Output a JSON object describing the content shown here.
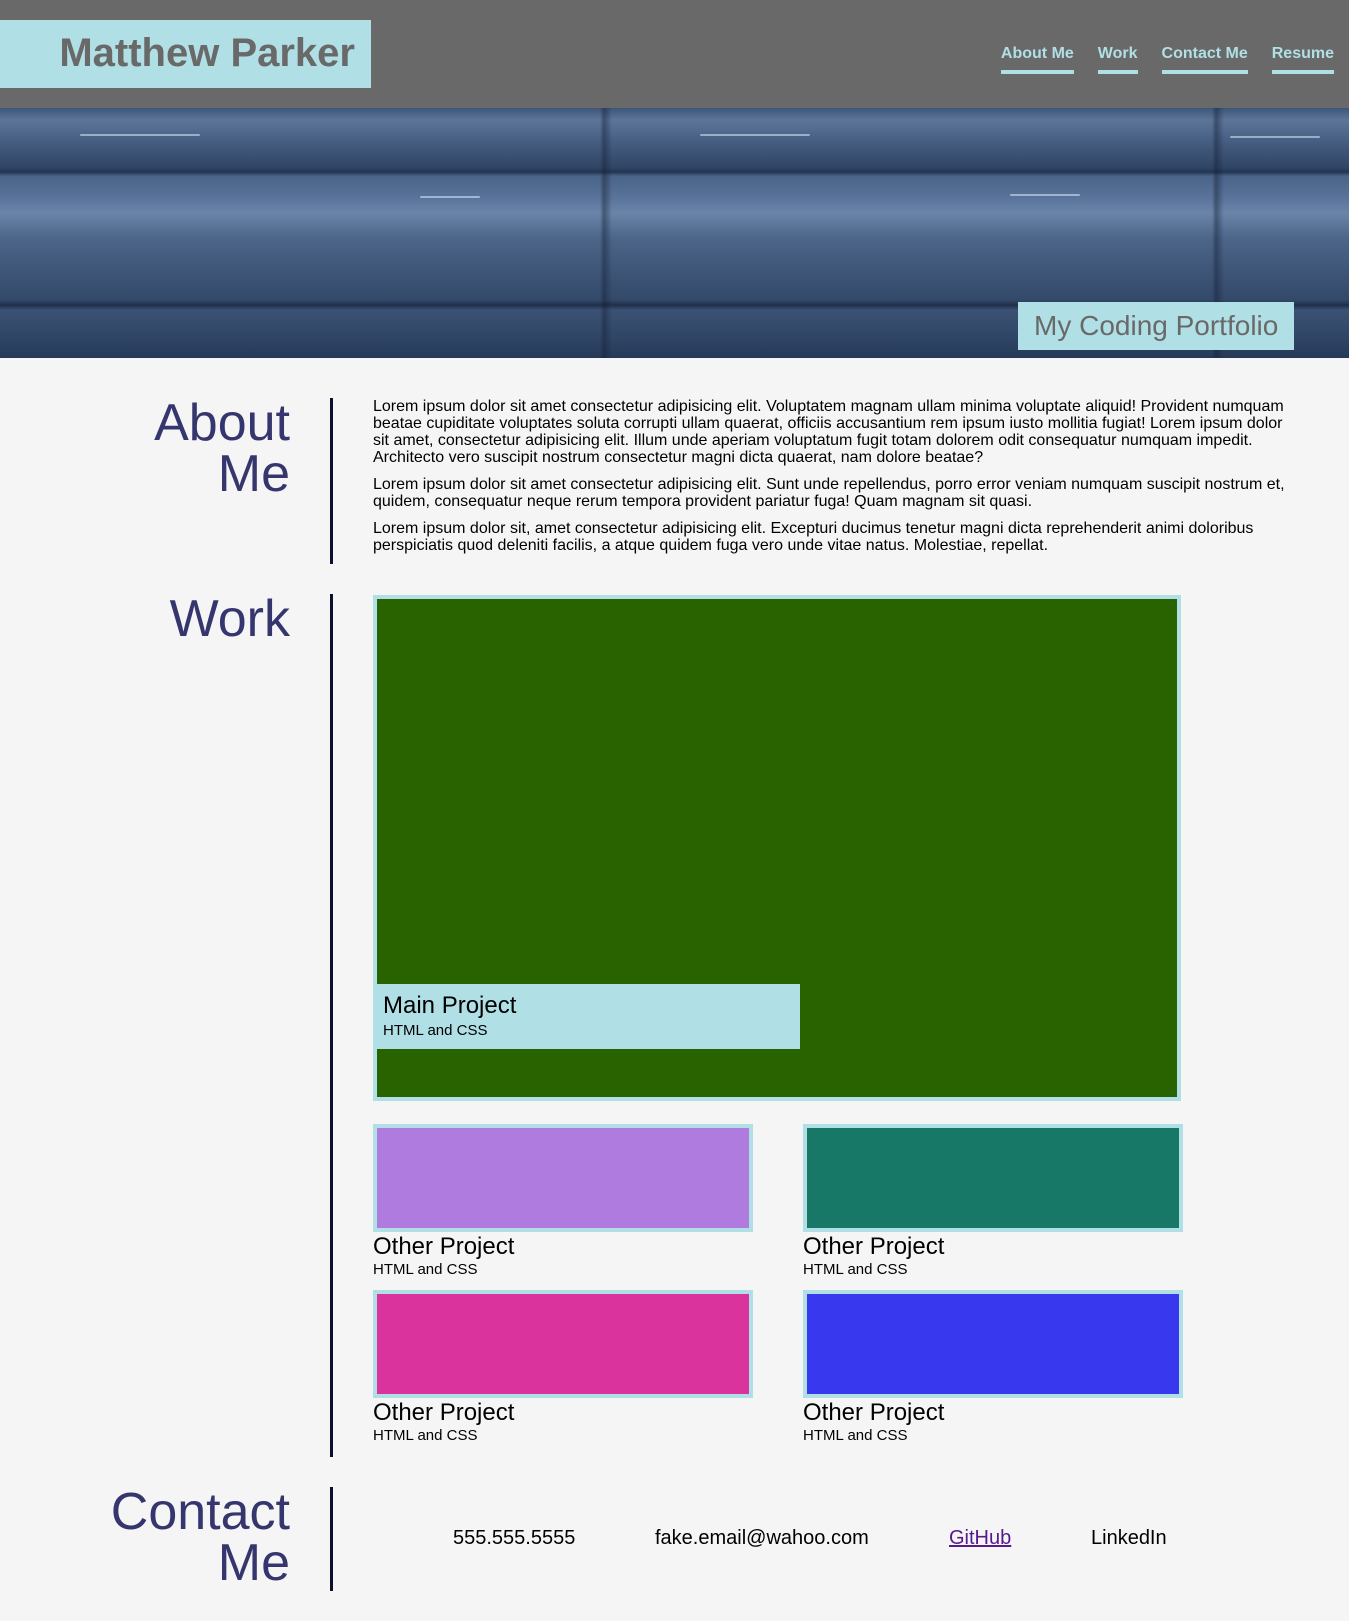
{
  "header": {
    "name": "Matthew Parker",
    "nav": [
      "About Me",
      "Work",
      "Contact Me",
      "Resume"
    ]
  },
  "hero": {
    "tagline": "My Coding Portfolio"
  },
  "about": {
    "title_line1": "About",
    "title_line2": "Me",
    "paragraphs": [
      "Lorem ipsum dolor sit amet consectetur adipisicing elit. Voluptatem magnam ullam minima voluptate aliquid! Provident numquam beatae cupiditate voluptates soluta corrupti ullam quaerat, officiis accusantium rem ipsum iusto mollitia fugiat! Lorem ipsum dolor sit amet, consectetur adipisicing elit. Illum unde aperiam voluptatum fugit totam dolorem odit consequatur numquam impedit. Architecto vero suscipit nostrum consectetur magni dicta quaerat, nam dolore beatae?",
      "Lorem ipsum dolor sit amet consectetur adipisicing elit. Sunt unde repellendus, porro error veniam numquam suscipit nostrum et, quidem, consequatur neque rerum tempora provident pariatur fuga! Quam magnam sit quasi.",
      "Lorem ipsum dolor sit, amet consectetur adipisicing elit. Excepturi ducimus tenetur magni dicta reprehenderit animi doloribus perspiciatis quod deleniti facilis, a atque quidem fuga vero unde vitae natus. Molestiae, repellat."
    ]
  },
  "work": {
    "title": "Work",
    "main_project": {
      "title": "Main Project",
      "subtitle": "HTML and CSS",
      "color": "#286300"
    },
    "other_projects": [
      {
        "title": "Other Project",
        "subtitle": "HTML and CSS",
        "color": "#af7bdf"
      },
      {
        "title": "Other Project",
        "subtitle": "HTML and CSS",
        "color": "#187868"
      },
      {
        "title": "Other Project",
        "subtitle": "HTML and CSS",
        "color": "#da339e"
      },
      {
        "title": "Other Project",
        "subtitle": "HTML and CSS",
        "color": "#3838ee"
      }
    ]
  },
  "contact": {
    "title_line1": "Contact",
    "title_line2": "Me",
    "phone": "555.555.5555",
    "email": "fake.email@wahoo.com",
    "github": "GitHub",
    "linkedin": "LinkedIn"
  },
  "colors": {
    "accent": "#b0dfe5",
    "header_bg": "#696969",
    "title_text": "#36366e",
    "page_bg": "#f5f5f5"
  }
}
